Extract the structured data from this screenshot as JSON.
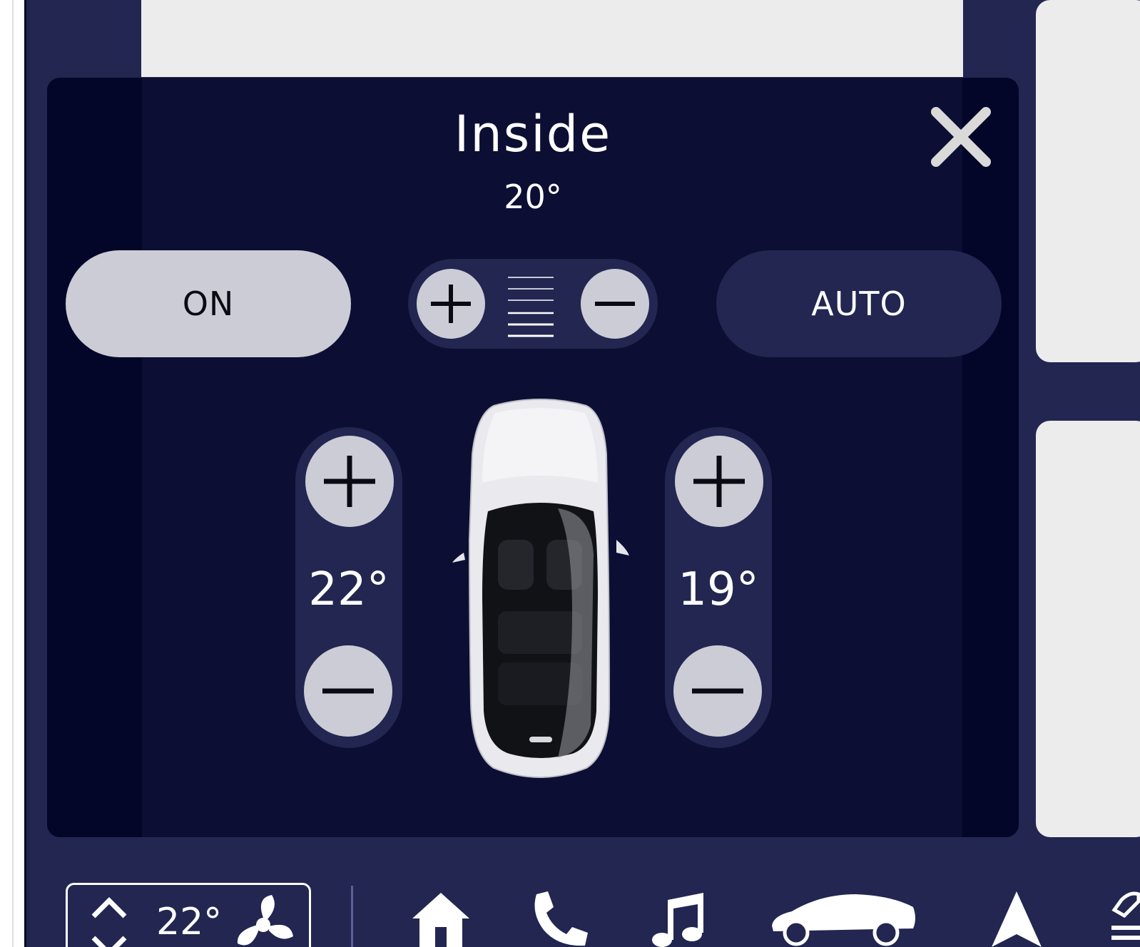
{
  "modal": {
    "title": "Inside",
    "inside_temperature": "20°",
    "power_button_label": "ON",
    "mode_button_label": "AUTO",
    "fan_level_lines": 5,
    "left_zone_temperature": "22°",
    "right_zone_temperature": "19°"
  },
  "bottom_bar": {
    "climate_temperature": "22°",
    "icons": [
      "chevron-up-icon",
      "chevron-down-icon",
      "fan-icon",
      "home-icon",
      "phone-icon",
      "music-icon",
      "car-icon",
      "navigation-icon",
      "edit-icon"
    ]
  },
  "colors": {
    "app_background": "#222651",
    "modal_background": "#0c0f33",
    "button_light": "#cbccd5",
    "text": "#ffffff"
  }
}
